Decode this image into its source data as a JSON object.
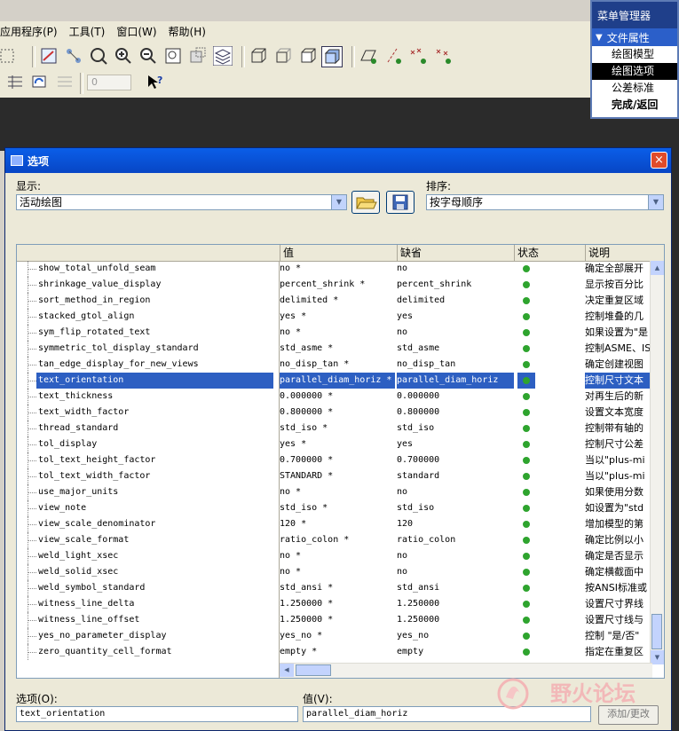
{
  "menubar": {
    "items": [
      "应用程序(P)",
      "工具(T)",
      "窗口(W)",
      "帮助(H)"
    ]
  },
  "toolbar": {
    "spin_value": "0"
  },
  "menu_manager": {
    "title": "菜单管理器",
    "submenu": "文件属性",
    "items": [
      "绘图模型",
      "绘图选项",
      "公差标准",
      "完成/返回"
    ]
  },
  "dialog": {
    "title": "选项",
    "close": "×",
    "show_label": "显示:",
    "show_value": "活动绘图",
    "sort_label": "排序:",
    "sort_value": "按字母顺序",
    "headers": {
      "value": "值",
      "default": "缺省",
      "status": "状态",
      "description": "说明"
    },
    "rows": [
      {
        "name": "show_total_unfold_seam",
        "value": "no *",
        "default": "no",
        "desc": "确定全部展开"
      },
      {
        "name": "shrinkage_value_display",
        "value": "percent_shrink *",
        "default": "percent_shrink",
        "desc": "显示按百分比"
      },
      {
        "name": "sort_method_in_region",
        "value": "delimited *",
        "default": "delimited",
        "desc": "决定重复区域"
      },
      {
        "name": "stacked_gtol_align",
        "value": "yes *",
        "default": "yes",
        "desc": "控制堆叠的几"
      },
      {
        "name": "sym_flip_rotated_text",
        "value": "no *",
        "default": "no",
        "desc": "如果设置为\"是"
      },
      {
        "name": "symmetric_tol_display_standard",
        "value": "std_asme *",
        "default": "std_asme",
        "desc": "控制ASME、IS"
      },
      {
        "name": "tan_edge_display_for_new_views",
        "value": "no_disp_tan *",
        "default": "no_disp_tan",
        "desc": "确定创建视图"
      },
      {
        "name": "text_orientation",
        "value": "parallel_diam_horiz *",
        "default": "parallel_diam_horiz",
        "desc": "控制尺寸文本",
        "selected": true
      },
      {
        "name": "text_thickness",
        "value": "0.000000 *",
        "default": "0.000000",
        "desc": "对再生后的新"
      },
      {
        "name": "text_width_factor",
        "value": "0.800000 *",
        "default": "0.800000",
        "desc": "设置文本宽度"
      },
      {
        "name": "thread_standard",
        "value": "std_iso *",
        "default": "std_iso",
        "desc": "控制带有轴的"
      },
      {
        "name": "tol_display",
        "value": "yes *",
        "default": "yes",
        "desc": "控制尺寸公差"
      },
      {
        "name": "tol_text_height_factor",
        "value": "0.700000 *",
        "default": "0.700000",
        "desc": "当以\"plus-mi"
      },
      {
        "name": "tol_text_width_factor",
        "value": "STANDARD *",
        "default": "standard",
        "desc": "当以\"plus-mi"
      },
      {
        "name": "use_major_units",
        "value": "no *",
        "default": "no",
        "desc": "如果使用分数"
      },
      {
        "name": "view_note",
        "value": "std_iso *",
        "default": "std_iso",
        "desc": "如设置为\"std"
      },
      {
        "name": "view_scale_denominator",
        "value": "120 *",
        "default": "120",
        "desc": "增加模型的第"
      },
      {
        "name": "view_scale_format",
        "value": "ratio_colon *",
        "default": "ratio_colon",
        "desc": "确定比例以小"
      },
      {
        "name": "weld_light_xsec",
        "value": "no *",
        "default": "no",
        "desc": "确定是否显示"
      },
      {
        "name": "weld_solid_xsec",
        "value": "no *",
        "default": "no",
        "desc": "确定横截面中"
      },
      {
        "name": "weld_symbol_standard",
        "value": "std_ansi *",
        "default": "std_ansi",
        "desc": "按ANSI标准或"
      },
      {
        "name": "witness_line_delta",
        "value": "1.250000 *",
        "default": "1.250000",
        "desc": "设置尺寸界线"
      },
      {
        "name": "witness_line_offset",
        "value": "1.250000 *",
        "default": "1.250000",
        "desc": "设置尺寸线与"
      },
      {
        "name": "yes_no_parameter_display",
        "value": "yes_no *",
        "default": "yes_no",
        "desc": "控制 \"是/否\""
      },
      {
        "name": "zero_quantity_cell_format",
        "value": "empty *",
        "default": "empty",
        "desc": "指定在重复区"
      }
    ],
    "option_label": "选项(O):",
    "option_value": "text_orientation",
    "value_label": "值(V):",
    "value_value": "parallel_diam_horiz",
    "add_button": "添加/更改"
  },
  "watermark": {
    "text": "野火论坛"
  },
  "colors": {
    "title_blue": "#0846c5",
    "selection": "#2d5fc2",
    "status_green": "#2ea42e"
  }
}
